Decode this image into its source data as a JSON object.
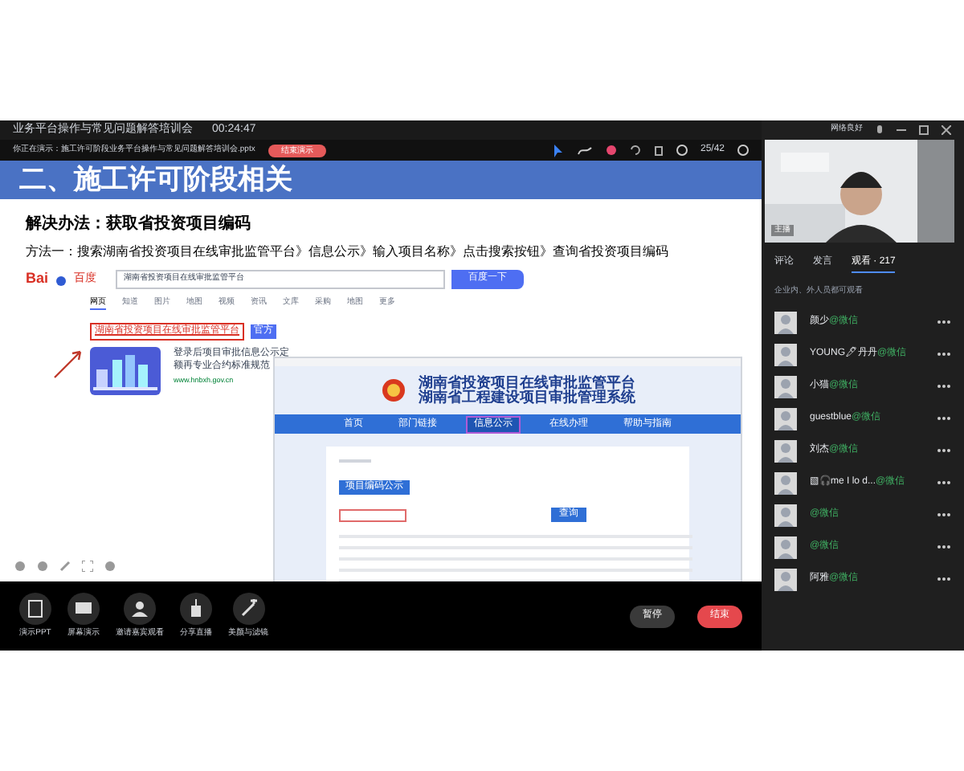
{
  "window": {
    "title": "业务平台操作与常见问题解答培训会",
    "timer": "00:24:47",
    "network": "网络良好"
  },
  "presenting": {
    "label": "你正在演示：施工许可阶段业务平台操作与常见问题解答培训会.pptx",
    "stop_button": "结束演示"
  },
  "slide_toolbar": {
    "page": "25/42"
  },
  "slide": {
    "title": "二、施工许可阶段相关",
    "heading": "解决办法：获取省投资项目编码",
    "method": "方法一：搜索湖南省投资项目在线审批监管平台》信息公示》输入项目名称》点击搜索按钮》查询省投资项目编码",
    "baidu": {
      "logo_text": "Bai",
      "logo_cn": "百度",
      "query": "湖南省投资项目在线审批监管平台",
      "button": "百度一下",
      "tabs": [
        {
          "label": "网页",
          "selected": true
        },
        {
          "label": "知道",
          "selected": false
        },
        {
          "label": "图片",
          "selected": false
        },
        {
          "label": "地图",
          "selected": false
        },
        {
          "label": "视频",
          "selected": false
        },
        {
          "label": "资讯",
          "selected": false
        },
        {
          "label": "文库",
          "selected": false
        },
        {
          "label": "采购",
          "selected": false
        },
        {
          "label": "地图",
          "selected": false
        },
        {
          "label": "更多",
          "selected": false
        }
      ],
      "result": {
        "title": "湖南省投资项目在线审批监管平台",
        "badge": "官方",
        "snippet": "登录后项目审批信息公示定额再专业合约标准规范",
        "url": "www.hnbxh.gov.cn"
      }
    },
    "site": {
      "title_1": "湖南省投资项目在线审批监管平台",
      "title_2": "湖南省工程建设项目审批管理系统",
      "nav": [
        {
          "label": "首页",
          "selected": false
        },
        {
          "label": "部门链接",
          "selected": false
        },
        {
          "label": "信息公示",
          "selected": true
        },
        {
          "label": "在线办理",
          "selected": false
        },
        {
          "label": "帮助与指南",
          "selected": false
        }
      ],
      "tab": "项目编码公示",
      "search_button": "查询"
    }
  },
  "webcam": {
    "kind": "picture",
    "label": "主播"
  },
  "panel": {
    "tabs": [
      {
        "label": "评论",
        "selected": false
      },
      {
        "label": "发言",
        "selected": false
      },
      {
        "label": "观看 · 217",
        "selected": true
      }
    ],
    "audience_note": "企业内、外人员都可观看",
    "viewers": [
      {
        "name": "颜少",
        "via": "@微信"
      },
      {
        "name": "YOUNG🖊丹丹",
        "via": "@微信"
      },
      {
        "name": "小猫",
        "via": "@微信"
      },
      {
        "name": "guestblue",
        "via": "@微信"
      },
      {
        "name": "刘杰",
        "via": "@微信"
      },
      {
        "name": "▧🎧me I lo d...",
        "via": "@微信"
      },
      {
        "via": "@微信"
      },
      {
        "via": "@微信"
      },
      {
        "name": "阿雅",
        "via": "@微信"
      }
    ]
  },
  "toolbar": {
    "tools": [
      {
        "label": "演示PPT",
        "kind": "doc"
      },
      {
        "label": "屏幕演示",
        "kind": "screen"
      },
      {
        "label": "邀请嘉宾观看",
        "kind": "invite"
      },
      {
        "label": "分享直播",
        "kind": "share"
      },
      {
        "label": "美颜与滤镜",
        "kind": "magic"
      }
    ],
    "pause": "暂停",
    "end": "结束"
  }
}
